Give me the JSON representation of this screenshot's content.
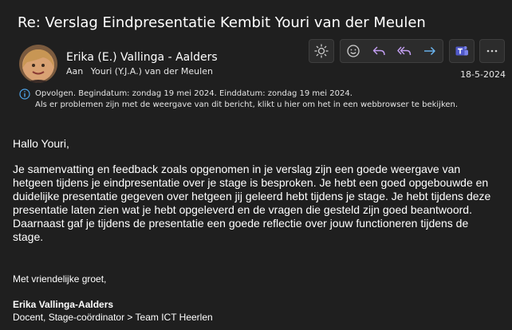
{
  "message": {
    "subject": "Re: Verslag Eindpresentatie Kembit Youri van der Meulen",
    "sender": "Erika (E.) Vallinga - Aalders",
    "to_label": "Aan",
    "to_recipient": "Youri (Y.J.A.) van der Meulen",
    "date": "18-5-2024",
    "info_line1": "Opvolgen.  Begindatum: zondag 19 mei 2024.  Einddatum: zondag 19 mei 2024.",
    "info_line2": "Als er problemen zijn met de weergave van dit bericht, klikt u hier om het in een webbrowser te bekijken."
  },
  "toolbar": {
    "icons": [
      "sun-icon",
      "emoji-icon",
      "reply-icon",
      "reply-all-icon",
      "forward-icon",
      "teams-icon",
      "more-icon"
    ]
  },
  "body": {
    "greeting": "Hallo Youri,",
    "paragraph": "Je samenvatting en feedback zoals opgenomen in je verslag zijn een goede weergave van hetgeen tijdens je eindpresentatie over je stage is besproken. Je hebt een goed opgebouwde en duidelijke presentatie gegeven over hetgeen jij geleerd hebt tijdens je stage. Je hebt tijdens deze presentatie laten zien wat je hebt opgeleverd en de vragen die gesteld zijn goed beantwoord. Daarnaast gaf je tijdens de presentatie een goede reflectie over jouw functioneren tijdens de stage.",
    "closing": "Met vriendelijke groet,",
    "signer_name": "Erika Vallinga-Aalders",
    "signer_role": "Docent, Stage-coördinator > Team ICT Heerlen"
  },
  "colors": {
    "background": "#1f1f1f",
    "accent_icon": "#c39ff2",
    "forward_icon": "#6cb8f6",
    "info_icon": "#4ea3e8"
  }
}
